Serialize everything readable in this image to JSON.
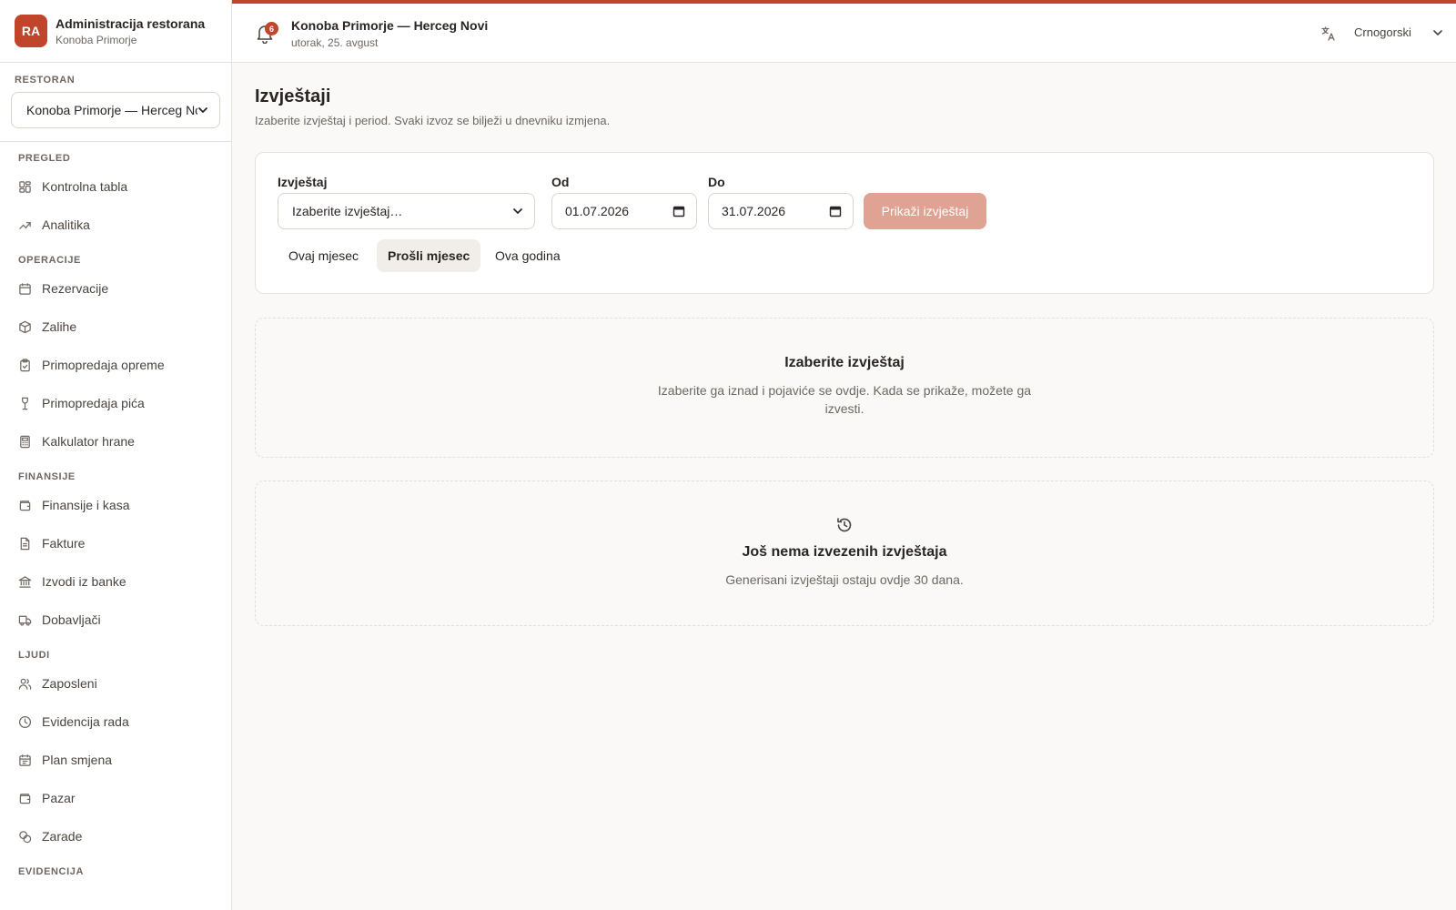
{
  "brand": {
    "initials": "RA",
    "title": "Administracija restorana",
    "subtitle": "Konoba Primorje"
  },
  "restaurant_selector": {
    "label": "RESTORAN",
    "value": "Konoba Primorje — Herceg Novi"
  },
  "nav": {
    "sections": [
      {
        "label": "PREGLED",
        "items": [
          {
            "label": "Kontrolna tabla",
            "icon": "dashboard-icon"
          },
          {
            "label": "Analitika",
            "icon": "trend-icon"
          }
        ]
      },
      {
        "label": "OPERACIJE",
        "items": [
          {
            "label": "Rezervacije",
            "icon": "calendar-icon"
          },
          {
            "label": "Zalihe",
            "icon": "package-icon"
          },
          {
            "label": "Primopredaja opreme",
            "icon": "clipboard-icon"
          },
          {
            "label": "Primopredaja pića",
            "icon": "wine-icon"
          },
          {
            "label": "Kalkulator hrane",
            "icon": "calculator-icon"
          }
        ]
      },
      {
        "label": "FINANSIJE",
        "items": [
          {
            "label": "Finansije i kasa",
            "icon": "wallet-icon"
          },
          {
            "label": "Fakture",
            "icon": "file-icon"
          },
          {
            "label": "Izvodi iz banke",
            "icon": "bank-icon"
          },
          {
            "label": "Dobavljači",
            "icon": "truck-icon"
          }
        ]
      },
      {
        "label": "LJUDI",
        "items": [
          {
            "label": "Zaposleni",
            "icon": "users-icon"
          },
          {
            "label": "Evidencija rada",
            "icon": "clock-icon"
          },
          {
            "label": "Plan smjena",
            "icon": "calendar-icon"
          },
          {
            "label": "Pazar",
            "icon": "wallet-icon"
          },
          {
            "label": "Zarade",
            "icon": "coins-icon"
          }
        ]
      },
      {
        "label": "EVIDENCIJA",
        "items": []
      }
    ]
  },
  "topbar": {
    "notification_count": "6",
    "title": "Konoba Primorje — Herceg Novi",
    "date": "utorak, 25. avgust",
    "language": "Crnogorski"
  },
  "page": {
    "title": "Izvještaji",
    "subtitle": "Izaberite izvještaj i period. Svaki izvoz se bilježi u dnevniku izmjena."
  },
  "filters": {
    "report_label": "Izvještaj",
    "report_value": "Izaberite izvještaj…",
    "from_label": "Od",
    "from_value": "01.07.2026",
    "to_label": "Do",
    "to_value": "31.07.2026",
    "show_button": "Prikaži izvještaj",
    "quick_ranges": [
      "Ovaj mjesec",
      "Prošli mjesec",
      "Ova godina"
    ],
    "active_range": "Prošli mjesec"
  },
  "empty_report": {
    "title": "Izaberite izvještaj",
    "text_line1": "Izaberite ga iznad i pojaviće se ovdje. Kada se prikaže, možete ga",
    "text_line2": "izvesti."
  },
  "empty_history": {
    "title": "Još nema izvezenih izvještaja",
    "text": "Generisani izvještaji ostaju ovdje 30 dana."
  },
  "colors": {
    "accent": "#c0452a",
    "button_disabled": "#dfa293",
    "muted_text": "#6f6760"
  }
}
